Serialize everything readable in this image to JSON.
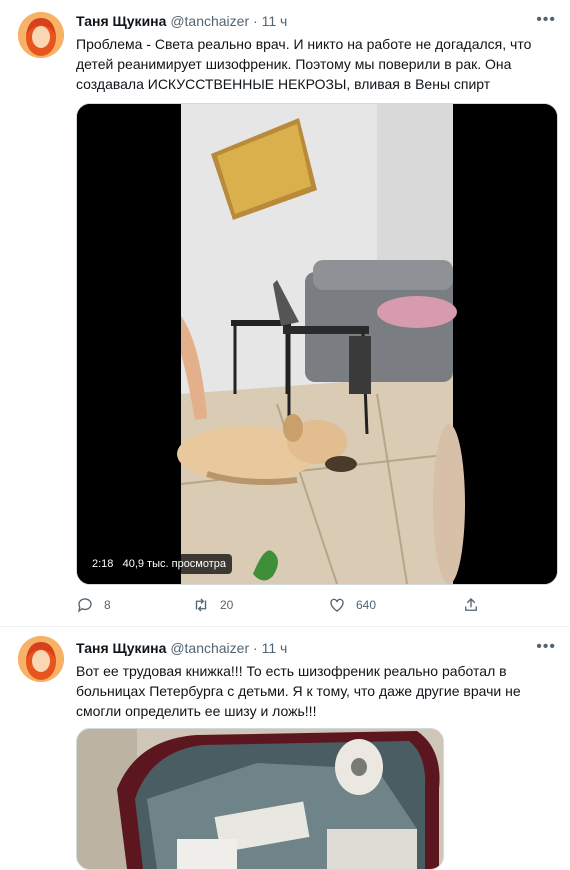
{
  "tweets": [
    {
      "author_name": "Таня Щукина",
      "handle": "@tanchaizer",
      "separator": "·",
      "time": "11 ч",
      "more": "•••",
      "text": "Проблема - Света реально врач. И никто на работе не догадался, что детей реанимирует шизофреник. Поэтому мы поверили в рак. Она создавала ИСКУССТВЕННЫЕ НЕКРОЗЫ, вливая в Вены спирт",
      "video": {
        "duration": "2:18",
        "views": "40,9 тыс. просмотра"
      },
      "actions": {
        "reply_count": "8",
        "retweet_count": "20",
        "like_count": "640"
      }
    },
    {
      "author_name": "Таня Щукина",
      "handle": "@tanchaizer",
      "separator": "·",
      "time": "11 ч",
      "more": "•••",
      "text": "Вот ее трудовая книжка!!! То есть шизофреник реально работал в больницах Петербурга с детьми. Я к тому, что даже другие врачи не смогли определить ее шизу и ложь!!!"
    }
  ],
  "icons": {
    "reply": "reply-icon",
    "retweet": "retweet-icon",
    "like": "heart-icon",
    "share": "share-icon",
    "more": "more-icon"
  },
  "colors": {
    "secondary_text": "#536471",
    "divider": "#eff3f4"
  }
}
